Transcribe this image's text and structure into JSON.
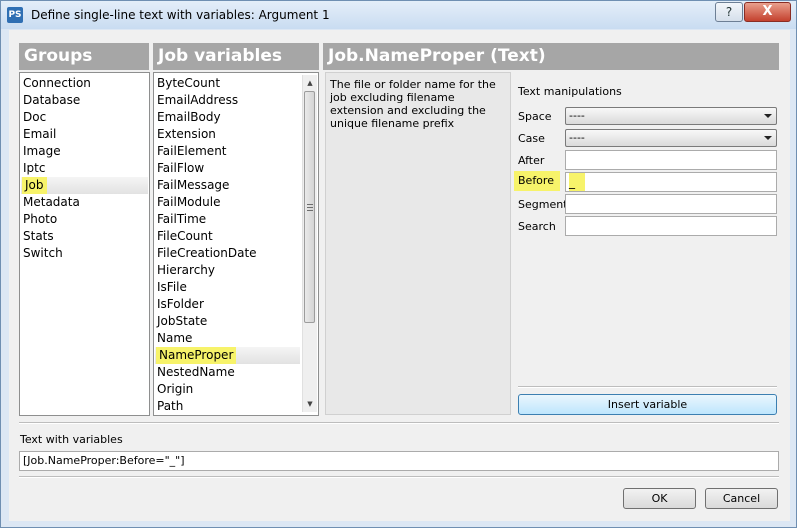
{
  "window": {
    "title": "Define single-line text with variables: Argument 1",
    "app_icon": "PS",
    "help_label": "?",
    "close_label": "X"
  },
  "groups": {
    "header": "Groups",
    "items": [
      "Connection",
      "Database",
      "Doc",
      "Email",
      "Image",
      "Iptc",
      "Job",
      "Metadata",
      "Photo",
      "Stats",
      "Switch"
    ],
    "selected": "Job"
  },
  "job_variables": {
    "header": "Job variables",
    "items": [
      "ByteCount",
      "EmailAddress",
      "EmailBody",
      "Extension",
      "FailElement",
      "FailFlow",
      "FailMessage",
      "FailModule",
      "FailTime",
      "FileCount",
      "FileCreationDate",
      "Hierarchy",
      "IsFile",
      "IsFolder",
      "JobState",
      "Name",
      "NameProper",
      "NestedName",
      "Origin",
      "Path"
    ],
    "selected": "NameProper"
  },
  "detail": {
    "header": "Job.NameProper (Text)",
    "description": "The file or folder name for the job excluding filename extension and excluding the unique filename prefix"
  },
  "text_manipulations": {
    "title": "Text manipulations",
    "space_label": "Space",
    "space_value": "----",
    "case_label": "Case",
    "case_value": "----",
    "after_label": "After",
    "after_value": "",
    "before_label": "Before",
    "before_value": "_",
    "segment_label": "Segment",
    "segment_value": "",
    "search_label": "Search",
    "search_value": ""
  },
  "insert_button": "Insert variable",
  "text_with_variables": {
    "label": "Text with variables",
    "value": "[Job.NameProper:Before=\"_\"]"
  },
  "buttons": {
    "ok": "OK",
    "cancel": "Cancel"
  },
  "colors": {
    "highlight": "#f7f36a",
    "header_bg": "#a6a6a6",
    "accent": "#3c7fb1"
  },
  "icons": {
    "scroll_up": "triangle-up-icon",
    "scroll_down": "triangle-down-icon",
    "combo": "chevron-down-icon",
    "thumb_grip": "grip-lines-icon"
  }
}
